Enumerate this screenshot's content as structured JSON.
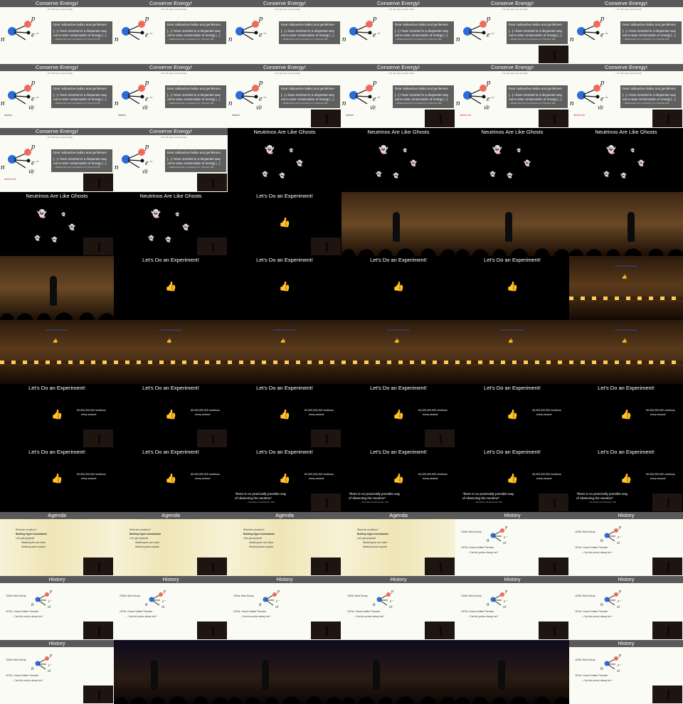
{
  "slides": {
    "conserve_title": "Conserve Energy!",
    "credit": "— P.S. Wir sehen uns! (W. Pauli)",
    "quote_l1": "Dear radioactive ladies and gentlemen",
    "quote_l2": "[...] I have resorted to a desperate way",
    "quote_l3": "out to save conservation of energy [...]",
    "quote_cite": "— Wolfgang Pauli, letter to Lise Meitner et al., 4 December 1930",
    "neutron_label": "neutron",
    "neutrino_label": "neutron·ino",
    "ghosts_title": "Neutrinos Are Like Ghosts",
    "experiment_title": "Let's Do an Experiment!",
    "neutrinos_l1": "60,000,000,000 neutrinos",
    "neutrinos_l2": "every second",
    "quote2_l1": "\"there is no practically possible way",
    "quote2_l2": "of observing the neutrino\"",
    "quote2_author": "— Hans Bethe & Rudolf Peierls, 1934",
    "agenda_title": "Agenda",
    "agenda_items": [
      "What are neutrinos?",
      "Building Hyper-Kamiokande",
      "Let's get physical!",
      "Watching the sun shine",
      "Watching stars explode"
    ],
    "history_title": "History",
    "history_l1": "1930s: Beta Decay",
    "history_l2": "1970s: Grand Unified Theories",
    "history_l3": "→ Can the proton decay too?"
  },
  "icons": {
    "ghost": "ghost-emoji",
    "thumbs_up": "thumbs-up-emoji"
  }
}
